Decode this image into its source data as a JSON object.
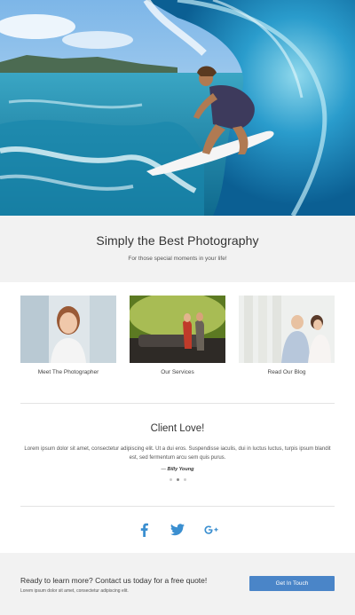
{
  "hero": {
    "image": "surfer-in-wave-photo"
  },
  "tagline": {
    "title": "Simply the Best Photography",
    "subtitle": "For those special moments in your life!"
  },
  "features": [
    {
      "label": "Meet The Photographer",
      "image": "woman-portrait-photo"
    },
    {
      "label": "Our Services",
      "image": "couple-at-car-photo"
    },
    {
      "label": "Read Our Blog",
      "image": "wedding-couple-photo"
    }
  ],
  "testimonial": {
    "title": "Client Love!",
    "quote": "Lorem ipsum dolor sit amet, consectetur adipiscing elit. Ut a dui eros. Suspendisse iaculis, dui in luctus luctus, turpis ipsum blandit est, sed fermentum arcu sem quis purus.",
    "author_prefix": "— ",
    "author": "Billy Young",
    "slides": 3,
    "active_slide": 2
  },
  "social": [
    {
      "name": "facebook-icon"
    },
    {
      "name": "twitter-icon"
    },
    {
      "name": "google-plus-icon"
    }
  ],
  "cta": {
    "heading": "Ready to learn more? Contact us today for a free quote!",
    "subtext": "Lorem ipsum dolor sit amet, consectetur adipiscing elit.",
    "button_label": "Get In Touch"
  },
  "colors": {
    "accent": "#4a85c8",
    "social_blue": "#3b8fd0",
    "band_gray": "#f2f2f2"
  }
}
